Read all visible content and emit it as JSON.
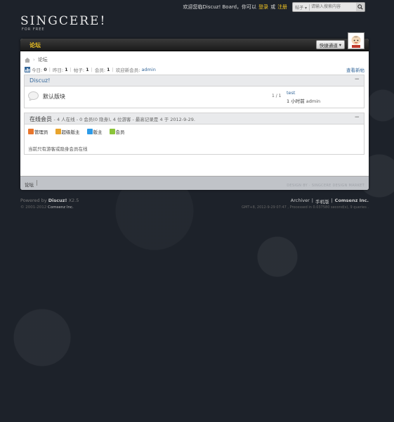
{
  "topbar": {
    "welcome": "欢迎您临Discuz! Board，你可以",
    "login": "登录",
    "or": "或",
    "register": "注册",
    "search_scope": "帖子",
    "search_placeholder": "请输入搜索内容"
  },
  "logo": {
    "name": "SINGCERE!",
    "sub": "FOR FREE"
  },
  "nav": {
    "forum_tab": "论坛",
    "quick_nav": "快捷通道"
  },
  "breadcrumb": {
    "current": "论坛"
  },
  "stats": {
    "today_label": "今日:",
    "today": "0",
    "yesterday_label": "昨日:",
    "yesterday": "1",
    "posts_label": "帖子:",
    "posts": "1",
    "members_label": "会员:",
    "members": "1",
    "welcome_new": "欢迎新会员:",
    "new_member": "admin",
    "latest_link": "查看新帖"
  },
  "category": {
    "title": "Discuz!",
    "forum": {
      "name": "默认版块",
      "counts": "1 / 1",
      "last_title": "test",
      "last_time_prefix": "1 小时前",
      "last_author": "admin"
    }
  },
  "online": {
    "title": "在线会员",
    "summary": "- 4 人在线 - 0 会员(0 隐身), 4 位游客 - 最高记录是 4 于 2012-9-29.",
    "legend": [
      {
        "label": "管理员",
        "color": "#e8762d"
      },
      {
        "label": "超级版主",
        "color": "#e8a42d"
      },
      {
        "label": "版主",
        "color": "#2d9be8"
      },
      {
        "label": "会员",
        "color": "#8bc43a"
      }
    ],
    "note": "当前只有游客或隐身会员在线"
  },
  "footer": {
    "link": "论坛",
    "faint": "DESIGN BY · SINGCERE DESIGN MARKET",
    "powered_by": "Powered by",
    "powered_brand": "Discuz!",
    "powered_version": "X2.5",
    "copyright": "© 2001-2012",
    "copyright_brand": "Comsenz Inc.",
    "archiver": "Archiver",
    "mobile": "手机版",
    "company": "Comsenz Inc.",
    "processed": "GMT+8, 2012-9-29 07:47 , Processed in 0.037580 second(s), 9 queries ."
  }
}
